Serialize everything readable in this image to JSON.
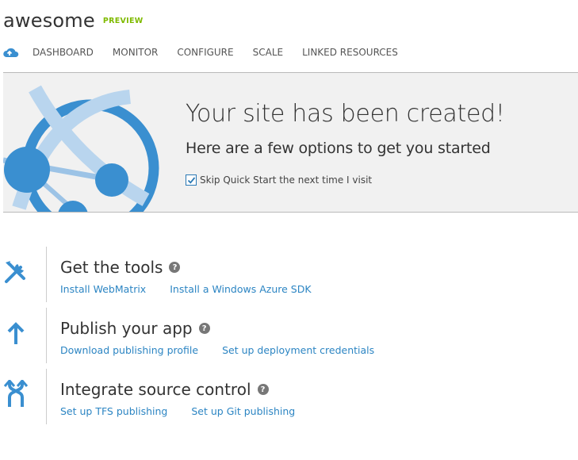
{
  "header": {
    "title": "awesome",
    "badge": "PREVIEW"
  },
  "nav": {
    "logo_icon": "cloud-icon",
    "tabs": [
      {
        "label": "DASHBOARD"
      },
      {
        "label": "MONITOR"
      },
      {
        "label": "CONFIGURE"
      },
      {
        "label": "SCALE"
      },
      {
        "label": "LINKED RESOURCES"
      }
    ]
  },
  "banner": {
    "heading": "Your site has been created!",
    "subheading": "Here are a few options to get you started",
    "skip_label": "Skip Quick Start the next time I visit",
    "skip_checked": true,
    "art_icon": "globe-network-icon"
  },
  "sections": [
    {
      "title": "Get the tools",
      "icon": "tools-icon",
      "links": [
        {
          "label": "Install WebMatrix"
        },
        {
          "label": "Install a Windows Azure SDK"
        }
      ]
    },
    {
      "title": "Publish your app",
      "icon": "upload-arrow-icon",
      "links": [
        {
          "label": "Download publishing profile"
        },
        {
          "label": "Set up deployment credentials"
        }
      ]
    },
    {
      "title": "Integrate source control",
      "icon": "source-control-icon",
      "links": [
        {
          "label": "Set up TFS publishing"
        },
        {
          "label": "Set up Git publishing"
        }
      ]
    }
  ],
  "colors": {
    "accent": "#2c85c3",
    "badge": "#7fba00",
    "banner_bg": "#f1f1f1",
    "icon_blue": "#3a8fd0"
  }
}
